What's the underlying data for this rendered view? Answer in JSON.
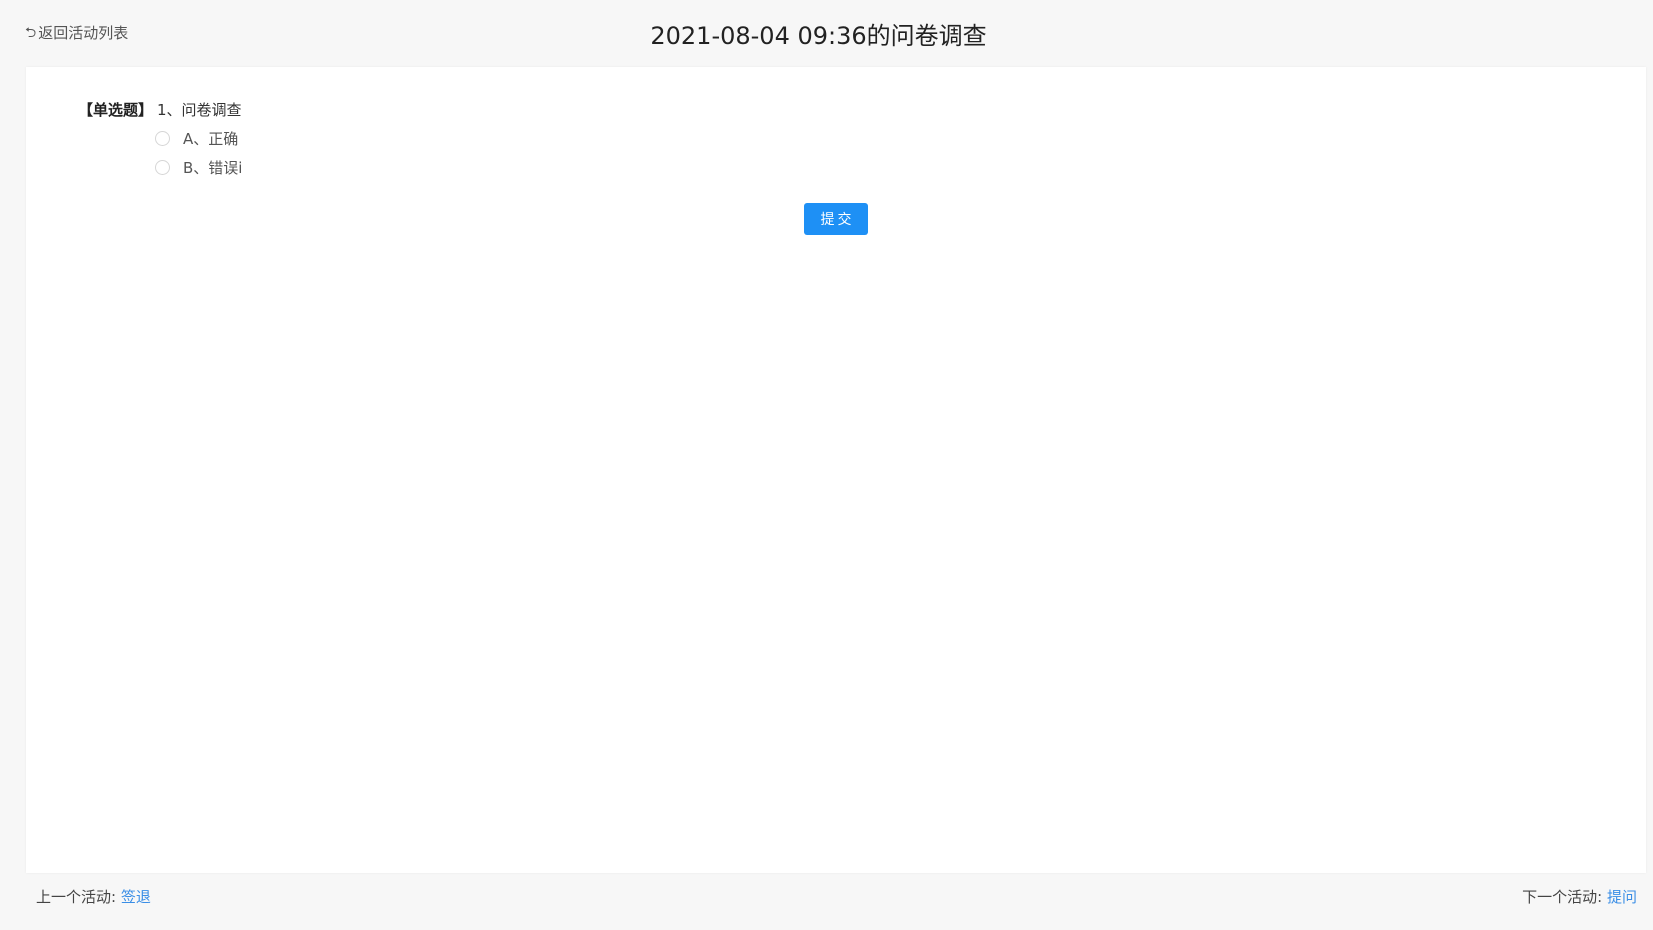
{
  "header": {
    "back_label": "返回活动列表",
    "title": "2021-08-04 09:36的问卷调查"
  },
  "question": {
    "type_label": "【单选题】",
    "text": "1、问卷调查",
    "options": [
      {
        "label": "A、正确"
      },
      {
        "label": "B、错误i"
      }
    ]
  },
  "submit_label": "提交",
  "footer": {
    "prev_prefix": "上一个活动: ",
    "prev_link": "签退",
    "next_prefix": "下一个活动: ",
    "next_link": "提问"
  },
  "colors": {
    "accent": "#1e90f5",
    "link": "#3a8ee6",
    "background": "#f7f7f7"
  },
  "icons": {
    "back": "undo-arrow-icon"
  }
}
